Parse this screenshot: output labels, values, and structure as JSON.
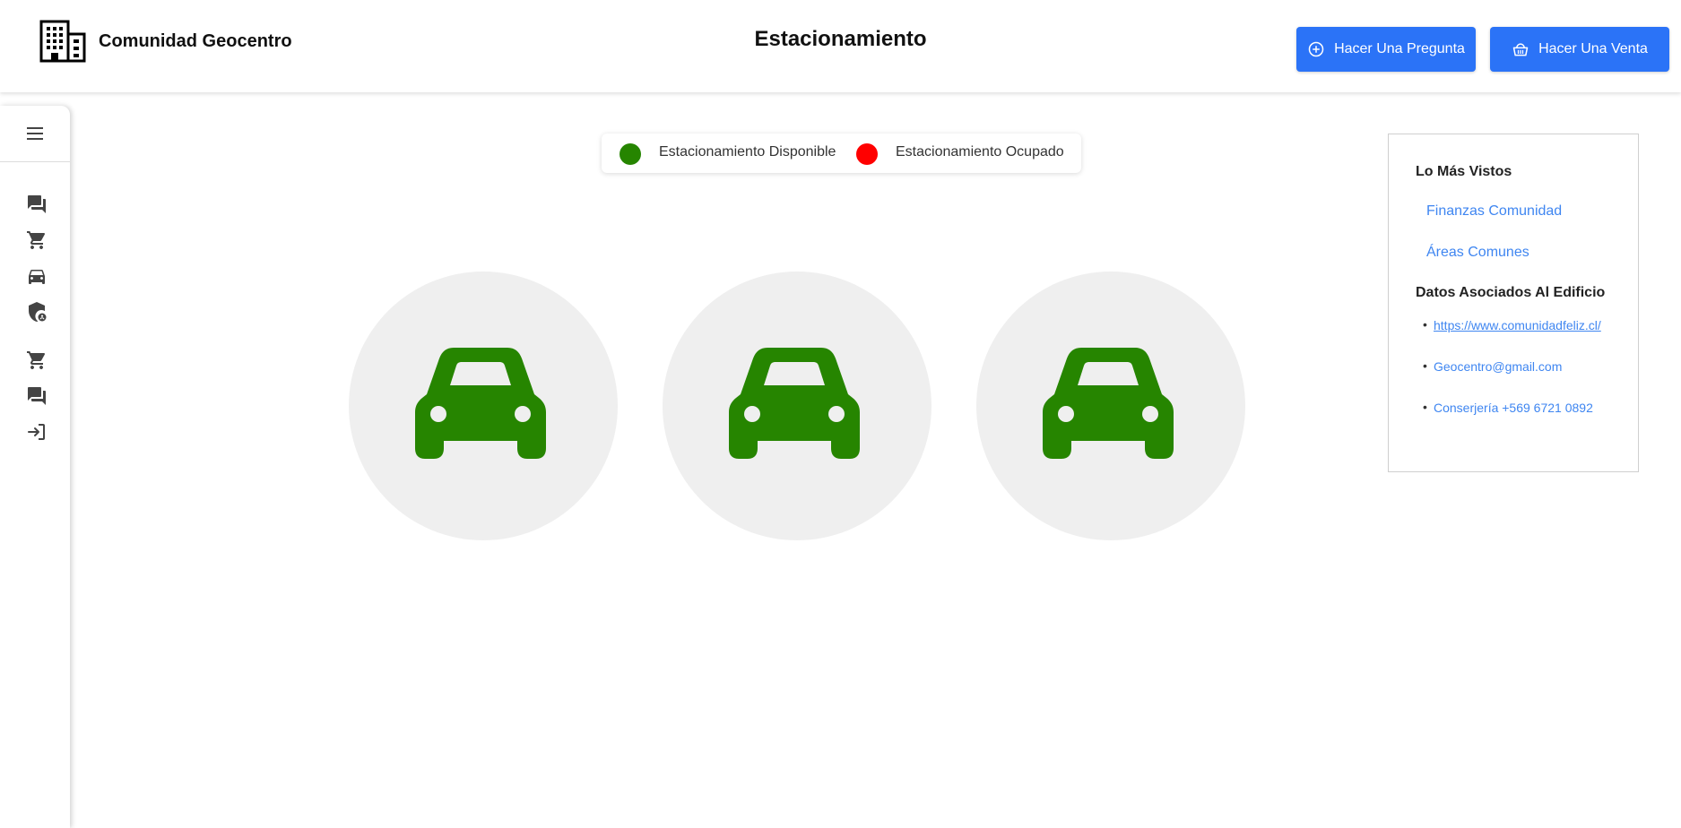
{
  "header": {
    "brand_name": "Comunidad Geocentro",
    "page_title": "Estacionamiento",
    "buttons": {
      "ask": "Hacer Una Pregunta",
      "sell": "Hacer Una Venta"
    },
    "accent_color": "#2b73f7"
  },
  "sidebar": {
    "icons": [
      "menu-icon",
      "chat-icon",
      "cart-icon",
      "car-icon",
      "security-icon",
      "cart-icon",
      "chat-icon",
      "logout-icon"
    ]
  },
  "legend": {
    "available": {
      "label": "Estacionamiento Disponible",
      "color": "#268500"
    },
    "occupied": {
      "label": "Estacionamiento Ocupado",
      "color": "#ff0000"
    }
  },
  "parking_spots": [
    {
      "status": "available"
    },
    {
      "status": "available"
    },
    {
      "status": "available"
    }
  ],
  "side_panel": {
    "most_viewed_title": "Lo Más Vistos",
    "most_viewed_links": [
      "Finanzas Comunidad",
      "Áreas Comunes"
    ],
    "building_data_title": "Datos Asociados Al Edificio",
    "building_data": [
      {
        "text": "https://www.comunidadfeliz.cl/",
        "underlined": true
      },
      {
        "text": "Geocentro@gmail.com",
        "underlined": false
      },
      {
        "text": "Conserjería +569 6721 0892",
        "underlined": false
      }
    ]
  }
}
